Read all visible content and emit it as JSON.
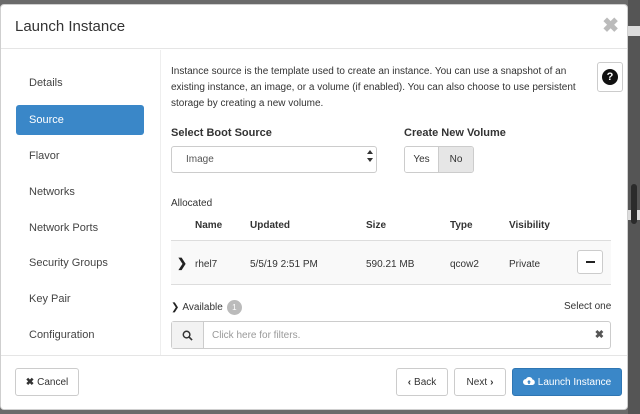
{
  "modal": {
    "title": "Launch Instance",
    "close_glyph": "✖"
  },
  "sidebar": {
    "items": [
      {
        "label": "Details",
        "active": false
      },
      {
        "label": "Source",
        "active": true
      },
      {
        "label": "Flavor",
        "active": false
      },
      {
        "label": "Networks",
        "active": false
      },
      {
        "label": "Network Ports",
        "active": false
      },
      {
        "label": "Security Groups",
        "active": false
      },
      {
        "label": "Key Pair",
        "active": false
      },
      {
        "label": "Configuration",
        "active": false
      }
    ]
  },
  "source": {
    "intro": "Instance source is the template used to create an instance. You can use a snapshot of an existing instance, an image, or a volume (if enabled). You can also choose to use persistent storage by creating a new volume.",
    "help_icon": "question-circle-icon",
    "boot_source_label": "Select Boot Source",
    "boot_source_value": "Image",
    "create_volume_label": "Create New Volume",
    "create_volume_yes": "Yes",
    "create_volume_no": "No",
    "create_volume_selected": "No"
  },
  "allocated": {
    "label": "Allocated",
    "columns": [
      "Name",
      "Updated",
      "Size",
      "Type",
      "Visibility"
    ],
    "rows": [
      {
        "name": "rhel7",
        "updated": "5/5/19 2:51 PM",
        "size": "590.21 MB",
        "type": "qcow2",
        "visibility": "Private"
      }
    ]
  },
  "available": {
    "label": "Available",
    "count": "1",
    "select_hint": "Select one",
    "filter_placeholder": "Click here for filters.",
    "clear_glyph": "✖"
  },
  "footer": {
    "cancel_label": "Cancel",
    "back_label": "Back",
    "next_label": "Next",
    "launch_label": "Launch Instance"
  },
  "colors": {
    "primary": "#3a87c8",
    "backdrop": "#6b6b6b"
  }
}
